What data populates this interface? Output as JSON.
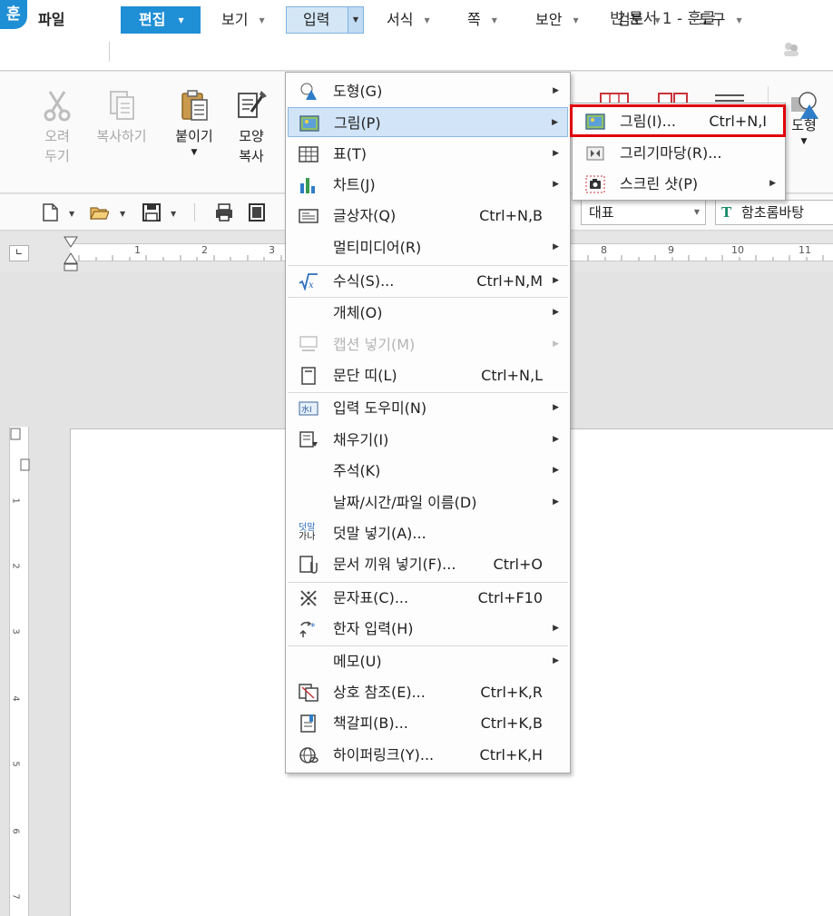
{
  "app": {
    "logo_text": "훈",
    "window_title": "빈 문서 1 - 훈글"
  },
  "menubar": {
    "file": "파일",
    "items": [
      {
        "label": "편집"
      },
      {
        "label": "보기"
      },
      {
        "label": "입력"
      },
      {
        "label": "서식"
      },
      {
        "label": "쪽"
      },
      {
        "label": "보안"
      },
      {
        "label": "검토"
      },
      {
        "label": "도구"
      }
    ]
  },
  "ribbon": {
    "cut": [
      "오려",
      "두기"
    ],
    "copy": "복사하기",
    "paste": "붙이기",
    "format_copy": [
      "모양",
      "복사"
    ],
    "shape": "도형"
  },
  "toolbar2": {
    "style_value": "대표",
    "font_icon": "T",
    "font_value": "함초롬바탕"
  },
  "ruler": {
    "h_numbers": [
      "1",
      "2",
      "3",
      "8",
      "9",
      "10",
      "11"
    ],
    "v_numbers": [
      "1",
      "2",
      "3",
      "4",
      "5",
      "6",
      "7"
    ]
  },
  "insert_menu": {
    "items": [
      {
        "icon": "shape-icon",
        "label": "도형(G)",
        "shortcut": "",
        "submenu": true
      },
      {
        "icon": "picture-icon",
        "label": "그림(P)",
        "shortcut": "",
        "submenu": true,
        "active": true
      },
      {
        "icon": "table-icon",
        "label": "표(T)",
        "shortcut": "",
        "submenu": true
      },
      {
        "icon": "chart-icon",
        "label": "차트(J)",
        "shortcut": "",
        "submenu": true
      },
      {
        "icon": "textbox-icon",
        "label": "글상자(Q)",
        "shortcut": "Ctrl+N,B",
        "submenu": false
      },
      {
        "icon": "",
        "label": "멀티미디어(R)",
        "shortcut": "",
        "submenu": true
      },
      {
        "icon": "formula-icon",
        "label": "수식(S)...",
        "shortcut": "Ctrl+N,M",
        "submenu": true
      },
      {
        "icon": "",
        "label": "개체(O)",
        "shortcut": "",
        "submenu": true
      },
      {
        "icon": "caption-icon",
        "label": "캡션 넣기(M)",
        "shortcut": "",
        "submenu": true,
        "disabled": true
      },
      {
        "icon": "column-break-icon",
        "label": "문단 띠(L)",
        "shortcut": "Ctrl+N,L",
        "submenu": false
      },
      {
        "icon": "input-helper-icon",
        "label": "입력 도우미(N)",
        "shortcut": "",
        "submenu": true
      },
      {
        "icon": "fill-icon",
        "label": "채우기(I)",
        "shortcut": "",
        "submenu": true
      },
      {
        "icon": "",
        "label": "주석(K)",
        "shortcut": "",
        "submenu": true
      },
      {
        "icon": "",
        "label": "날짜/시간/파일 이름(D)",
        "shortcut": "",
        "submenu": true
      },
      {
        "icon": "overlay-text-icon",
        "label": "덧말 넣기(A)...",
        "shortcut": "",
        "submenu": false
      },
      {
        "icon": "insert-doc-icon",
        "label": "문서 끼워 넣기(F)...",
        "shortcut": "Ctrl+O",
        "submenu": false
      },
      {
        "icon": "symbol-icon",
        "label": "문자표(C)...",
        "shortcut": "Ctrl+F10",
        "submenu": false
      },
      {
        "icon": "hanja-icon",
        "label": "한자 입력(H)",
        "shortcut": "",
        "submenu": true
      },
      {
        "icon": "",
        "label": "메모(U)",
        "shortcut": "",
        "submenu": true
      },
      {
        "icon": "cross-ref-icon",
        "label": "상호 참조(E)...",
        "shortcut": "Ctrl+K,R",
        "submenu": false
      },
      {
        "icon": "bookmark-icon",
        "label": "책갈피(B)...",
        "shortcut": "Ctrl+K,B",
        "submenu": false
      },
      {
        "icon": "hyperlink-icon",
        "label": "하이퍼링크(Y)...",
        "shortcut": "Ctrl+K,H",
        "submenu": false
      }
    ],
    "overlay_icon_text": [
      "덧말",
      "가나"
    ]
  },
  "picture_submenu": {
    "items": [
      {
        "icon": "picture-icon",
        "label": "그림(I)...",
        "shortcut": "Ctrl+N,I",
        "submenu": false
      },
      {
        "icon": "drawing-icon",
        "label": "그리기마당(R)...",
        "shortcut": "",
        "submenu": false
      },
      {
        "icon": "screenshot-icon",
        "label": "스크린 샷(P)",
        "shortcut": "",
        "submenu": true
      }
    ]
  },
  "colors": {
    "accent": "#1f8fd6",
    "highlight": "#e0000b",
    "active_item": "#d2e4f7"
  }
}
